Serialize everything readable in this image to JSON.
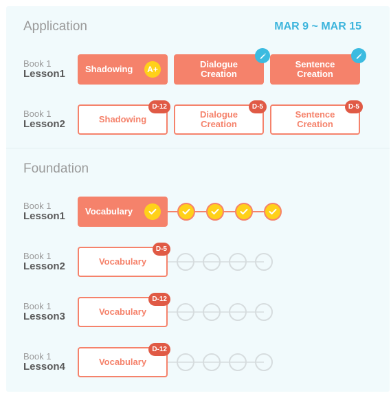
{
  "application": {
    "title": "Application",
    "date_range": "MAR 9 ~ MAR 15",
    "rows": [
      {
        "book": "Book 1",
        "lesson": "Lesson1",
        "activities": [
          {
            "label": "Shadowing",
            "badge": "A+"
          },
          {
            "label": "Dialogue Creation",
            "icon": "pencil-icon"
          },
          {
            "label": "Sentence Creation",
            "icon": "pencil-icon"
          }
        ]
      },
      {
        "book": "Book 1",
        "lesson": "Lesson2",
        "activities": [
          {
            "label": "Shadowing",
            "badge": "D-12"
          },
          {
            "label": "Dialogue Creation",
            "badge": "D-5"
          },
          {
            "label": "Sentence Creation",
            "badge": "D-5"
          }
        ]
      }
    ]
  },
  "foundation": {
    "title": "Foundation",
    "rows": [
      {
        "book": "Book 1",
        "lesson": "Lesson1",
        "activity": "Vocabulary",
        "completed_steps": 4,
        "total_steps": 4,
        "check_icon": "check-icon"
      },
      {
        "book": "Book 1",
        "lesson": "Lesson2",
        "activity": "Vocabulary",
        "badge": "D-5",
        "completed_steps": 0,
        "total_steps": 4
      },
      {
        "book": "Book 1",
        "lesson": "Lesson3",
        "activity": "Vocabulary",
        "badge": "D-12",
        "completed_steps": 0,
        "total_steps": 4
      },
      {
        "book": "Book 1",
        "lesson": "Lesson4",
        "activity": "Vocabulary",
        "badge": "D-12",
        "completed_steps": 0,
        "total_steps": 4
      }
    ]
  },
  "colors": {
    "accent": "#f5826b",
    "badge_red": "#e05a45",
    "check_yellow": "#ffd11a",
    "edit_blue": "#3cbbe0",
    "date_blue": "#3cb4dc",
    "panel_bg": "#f1fafc"
  }
}
